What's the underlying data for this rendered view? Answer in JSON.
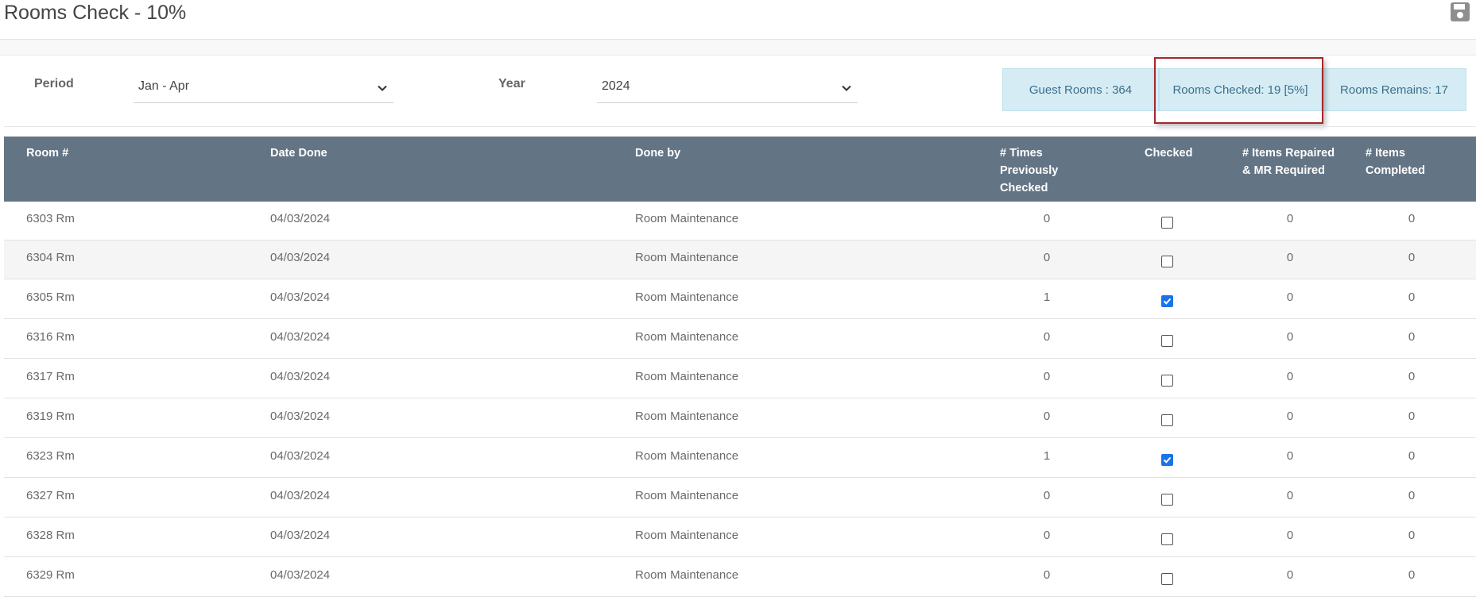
{
  "page": {
    "title": "Rooms Check - 10%"
  },
  "filters": {
    "period_label": "Period",
    "period_value": "Jan - Apr",
    "year_label": "Year",
    "year_value": "2024"
  },
  "stats": {
    "guest_rooms": "Guest Rooms : 364",
    "rooms_checked": "Rooms Checked: 19 [5%]",
    "rooms_remains": "Rooms Remains: 17"
  },
  "table": {
    "columns": {
      "room": "Room #",
      "date_done": "Date Done",
      "done_by": "Done by",
      "times_checked_1": "# Times",
      "times_checked_2": "Previously",
      "times_checked_3": "Checked",
      "checked": "Checked",
      "items_repaired_1": "# Items Repaired",
      "items_repaired_2": "& MR Required",
      "items_completed_1": "# Items",
      "items_completed_2": "Completed"
    },
    "rows": [
      {
        "room": "6303 Rm",
        "date": "04/03/2024",
        "done_by": "Room Maintenance",
        "times": "0",
        "checked": false,
        "repaired": "0",
        "completed": "0"
      },
      {
        "room": "6304 Rm",
        "date": "04/03/2024",
        "done_by": "Room Maintenance",
        "times": "0",
        "checked": false,
        "repaired": "0",
        "completed": "0"
      },
      {
        "room": "6305 Rm",
        "date": "04/03/2024",
        "done_by": "Room Maintenance",
        "times": "1",
        "checked": true,
        "repaired": "0",
        "completed": "0"
      },
      {
        "room": "6316 Rm",
        "date": "04/03/2024",
        "done_by": "Room Maintenance",
        "times": "0",
        "checked": false,
        "repaired": "0",
        "completed": "0"
      },
      {
        "room": "6317 Rm",
        "date": "04/03/2024",
        "done_by": "Room Maintenance",
        "times": "0",
        "checked": false,
        "repaired": "0",
        "completed": "0"
      },
      {
        "room": "6319 Rm",
        "date": "04/03/2024",
        "done_by": "Room Maintenance",
        "times": "0",
        "checked": false,
        "repaired": "0",
        "completed": "0"
      },
      {
        "room": "6323 Rm",
        "date": "04/03/2024",
        "done_by": "Room Maintenance",
        "times": "1",
        "checked": true,
        "repaired": "0",
        "completed": "0"
      },
      {
        "room": "6327 Rm",
        "date": "04/03/2024",
        "done_by": "Room Maintenance",
        "times": "0",
        "checked": false,
        "repaired": "0",
        "completed": "0"
      },
      {
        "room": "6328 Rm",
        "date": "04/03/2024",
        "done_by": "Room Maintenance",
        "times": "0",
        "checked": false,
        "repaired": "0",
        "completed": "0"
      },
      {
        "room": "6329 Rm",
        "date": "04/03/2024",
        "done_by": "Room Maintenance",
        "times": "0",
        "checked": false,
        "repaired": "0",
        "completed": "0"
      }
    ]
  },
  "colors": {
    "header_bg": "#637485",
    "stat_bg": "#d6ecf4",
    "highlight_border": "#a5272c",
    "checkbox_on": "#1a73e8"
  },
  "icons": {
    "save": "floppy-disk-icon",
    "dropdown": "chevron-down-icon",
    "check": "checkmark-icon"
  }
}
